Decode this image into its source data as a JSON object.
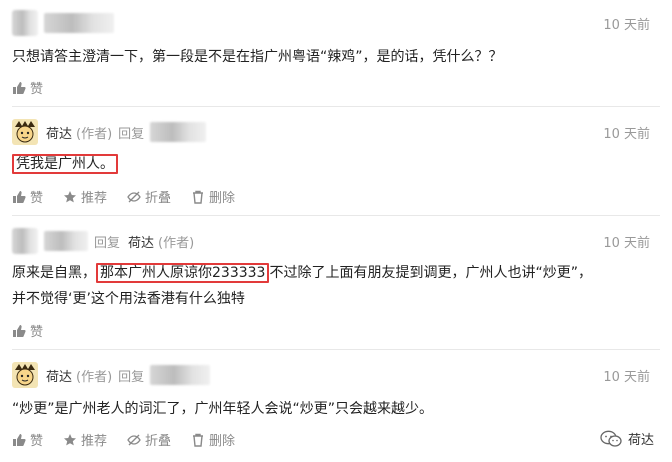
{
  "comments": [
    {
      "name": "",
      "time": "10 天前",
      "text": "只想请答主澄清一下，第一段是不是在指广州粤语“辣鸡”，是的话，凭什么？？",
      "actions": {
        "like": "赞"
      }
    },
    {
      "name": "荷达",
      "tag": "(作者)",
      "reply": "回复",
      "time": "10 天前",
      "text": "凭我是广州人。",
      "actions": {
        "like": "赞",
        "recommend": "推荐",
        "fold": "折叠",
        "delete": "删除"
      }
    },
    {
      "reply": "回复",
      "reply_to": "荷达",
      "reply_to_tag": "(作者)",
      "time": "10 天前",
      "text_pre": "原来是自黑，",
      "text_highlight": "那本广州人原谅你233333",
      "text_post": "不过除了上面有朋友提到调更，广州人也讲“炒更”，",
      "text_line2": "并不觉得‘更’这个用法香港有什么独特",
      "actions": {
        "like": "赞"
      }
    },
    {
      "name": "荷达",
      "tag": "(作者)",
      "reply": "回复",
      "time": "10 天前",
      "text": "“炒更”是广州老人的词汇了，广州年轻人会说“炒更”只会越来越少。",
      "actions": {
        "like": "赞",
        "recommend": "推荐",
        "fold": "折叠",
        "delete": "删除"
      }
    }
  ],
  "watermark": {
    "label": "荷达",
    "icon": "wechat-icon"
  }
}
